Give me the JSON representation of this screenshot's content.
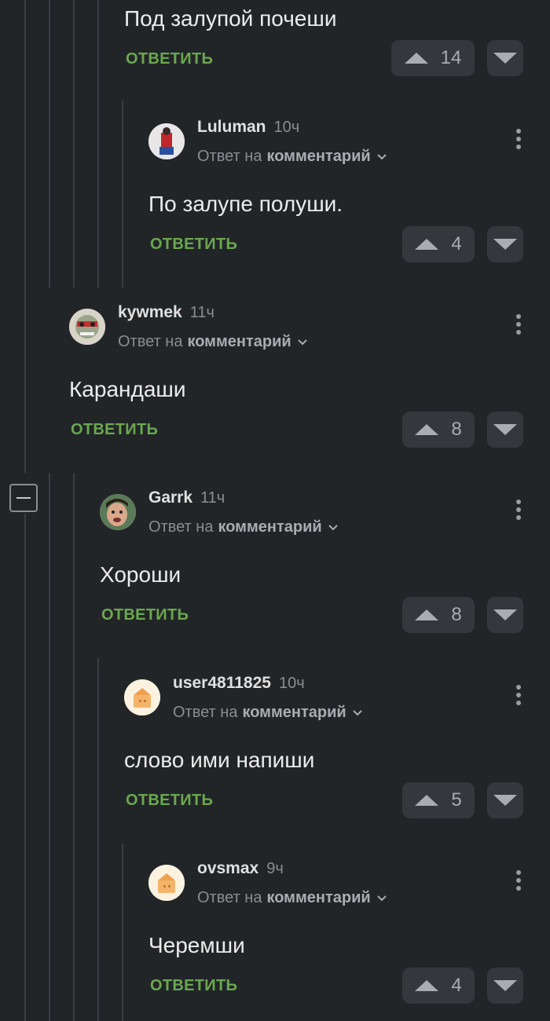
{
  "top_comment": {
    "text": "Под залупой почеши",
    "reply_label": "ОТВЕТИТЬ",
    "votes": "14"
  },
  "comments": [
    {
      "author": "Luluman",
      "time": "10ч",
      "reply_prefix": "Ответ на",
      "reply_target": "комментарий",
      "text": "По залупе полуши.",
      "reply_label": "ОТВЕТИТЬ",
      "votes": "4"
    },
    {
      "author": "kywmek",
      "time": "11ч",
      "reply_prefix": "Ответ на",
      "reply_target": "комментарий",
      "text": "Карандаши",
      "reply_label": "ОТВЕТИТЬ",
      "votes": "8"
    },
    {
      "author": "Garrk",
      "time": "11ч",
      "reply_prefix": "Ответ на",
      "reply_target": "комментарий",
      "text": "Хороши",
      "reply_label": "ОТВЕТИТЬ",
      "votes": "8"
    },
    {
      "author": "user4811825",
      "time": "10ч",
      "reply_prefix": "Ответ на",
      "reply_target": "комментарий",
      "text": "слово ими напиши",
      "reply_label": "ОТВЕТИТЬ",
      "votes": "5"
    },
    {
      "author": "ovsmax",
      "time": "9ч",
      "reply_prefix": "Ответ на",
      "reply_target": "комментарий",
      "text": "Черемши",
      "reply_label": "ОТВЕТИТЬ",
      "votes": "4"
    }
  ],
  "icons": {
    "upvote": "triangle-up-icon",
    "downvote": "triangle-down-icon",
    "more": "vertical-dots-icon",
    "expand": "chevron-down-icon",
    "collapse": "minus-icon"
  },
  "colors": {
    "background": "#222528",
    "reply_green": "#6aa84f",
    "vote_bg": "#34383c",
    "thread_line": "#3a3d41"
  }
}
